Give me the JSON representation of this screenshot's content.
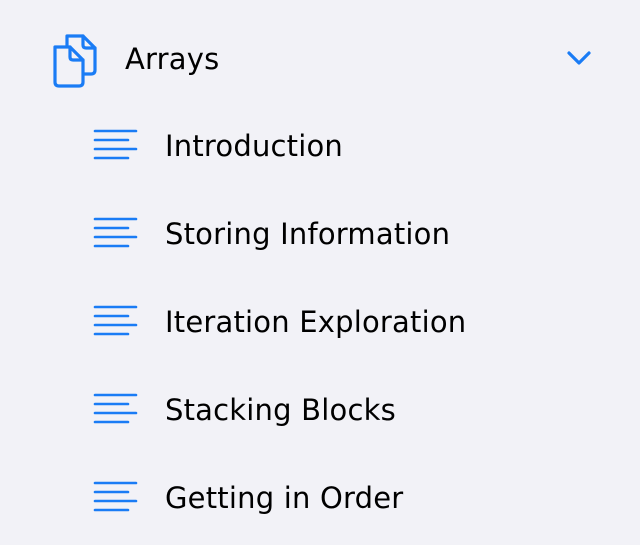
{
  "section": {
    "title": "Arrays",
    "icon": "documents-icon",
    "expanded": true,
    "chevron_icon": "chevron-down-icon"
  },
  "accent_color": "#1a7cf5",
  "items": [
    {
      "label": "Introduction",
      "icon": "text-lines-icon"
    },
    {
      "label": "Storing Information",
      "icon": "text-lines-icon"
    },
    {
      "label": "Iteration Exploration",
      "icon": "text-lines-icon"
    },
    {
      "label": "Stacking Blocks",
      "icon": "text-lines-icon"
    },
    {
      "label": "Getting in Order",
      "icon": "text-lines-icon"
    }
  ]
}
